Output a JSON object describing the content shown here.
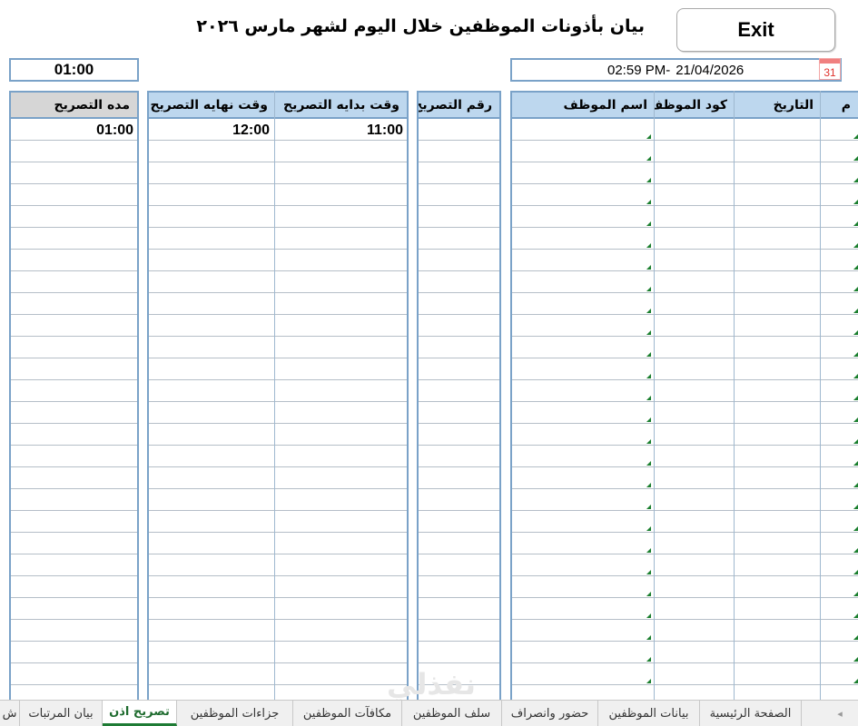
{
  "header": {
    "title": "بيان بأذونات الموظفين خلال اليوم لشهر مارس ٢٠٢٦",
    "exit_label": "Exit"
  },
  "summary": {
    "total_duration": "01:00",
    "current_time": "02:59 PM-",
    "current_date": "21/04/2026",
    "calendar_day": "31"
  },
  "permits_table": {
    "columns": {
      "duration": "مده التصريح",
      "end_time": "وقت نهايه التصريح",
      "start_time": "وقت بدايه التصريح",
      "permit_no": "رقم التصريح",
      "emp_name": "اسم الموظف",
      "emp_code": "كود الموظف",
      "date": "التاريخ",
      "serial": "م"
    },
    "rows": [
      {
        "duration": "01:00",
        "end_time": "12:00",
        "start_time": "11:00"
      }
    ]
  },
  "sheet_tabs": [
    {
      "label": "الصفحة الرئيسية",
      "active": false
    },
    {
      "label": "بيانات الموظفين",
      "active": false
    },
    {
      "label": "حضور وانصراف",
      "active": false
    },
    {
      "label": "سلف الموظفين",
      "active": false
    },
    {
      "label": "مكافآت الموظفين",
      "active": false
    },
    {
      "label": "جزاءات الموظفين",
      "active": false
    },
    {
      "label": "تصريح اذن",
      "active": true
    },
    {
      "label": "بيان المرتبات",
      "active": false
    },
    {
      "label": "ش",
      "active": false
    }
  ],
  "watermark": "نفذلي",
  "colors": {
    "header_blue": "#bdd7ee",
    "border_blue": "#7aa2c8",
    "header_gray": "#d6d6d6",
    "active_tab_green": "#1e7b34"
  }
}
